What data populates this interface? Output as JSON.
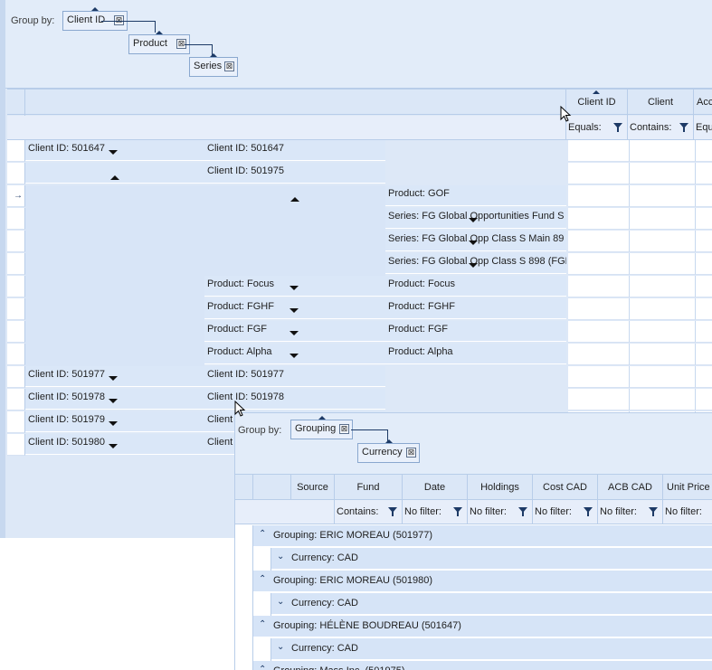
{
  "grid_a": {
    "group_by_label": "Group by:",
    "chips": [
      "Client ID",
      "Product",
      "Series"
    ],
    "columns": [
      "Client ID",
      "Client",
      "Acc"
    ],
    "filters": [
      "Equals:",
      "Contains:",
      "Equ"
    ],
    "row_indicator": "→",
    "rows": [
      {
        "l1": "Client ID: 501647",
        "l2": "Client ID: 501647"
      },
      {
        "l1": "",
        "l2": "Client ID: 501975"
      },
      {
        "l3": "Product: GOF"
      },
      {
        "l3": "Series: FG Global Opportunities Fund S"
      },
      {
        "l3": "Series: FG Global Opp Class S Main 89"
      },
      {
        "l3": "Series: FG Global Opp Class S 898 (FGL"
      },
      {
        "l2": "Product: Focus",
        "l3": "Product: Focus"
      },
      {
        "l2": "Product: FGHF",
        "l3": "Product: FGHF"
      },
      {
        "l2": "Product: FGF",
        "l3": "Product: FGF"
      },
      {
        "l2": "Product: Alpha",
        "l3": "Product: Alpha"
      },
      {
        "l1": "Client ID: 501977",
        "l2": "Client ID: 501977"
      },
      {
        "l1": "Client ID: 501978",
        "l2": "Client ID: 501978"
      },
      {
        "l1": "Client ID: 501979",
        "l2": "Client"
      },
      {
        "l1": "Client ID: 501980",
        "l2": "Client"
      }
    ]
  },
  "grid_b": {
    "group_by_label": "Group by:",
    "chips": [
      "Grouping",
      "Currency"
    ],
    "columns": [
      "Source",
      "Fund",
      "Date",
      "Holdings",
      "Cost CAD",
      "ACB CAD",
      "Unit Price ("
    ],
    "filters": [
      "Contains:",
      "No filter:",
      "No filter:",
      "No filter:",
      "No filter:",
      "No filter:"
    ],
    "rows": [
      {
        "level": 1,
        "text": "Grouping: ERIC MOREAU (501977)"
      },
      {
        "level": 2,
        "text": "Currency: CAD"
      },
      {
        "level": 1,
        "text": "Grouping: ERIC MOREAU (501980)"
      },
      {
        "level": 2,
        "text": "Currency: CAD"
      },
      {
        "level": 1,
        "text": "Grouping: HÉLÈNE BOUDREAU (501647)"
      },
      {
        "level": 2,
        "text": "Currency: CAD"
      },
      {
        "level": 1,
        "text": "Grouping: Mass Inc. (501975)"
      }
    ]
  },
  "icons": {
    "remove": "⊠",
    "collapse": "⌃",
    "expand": "⌄"
  }
}
